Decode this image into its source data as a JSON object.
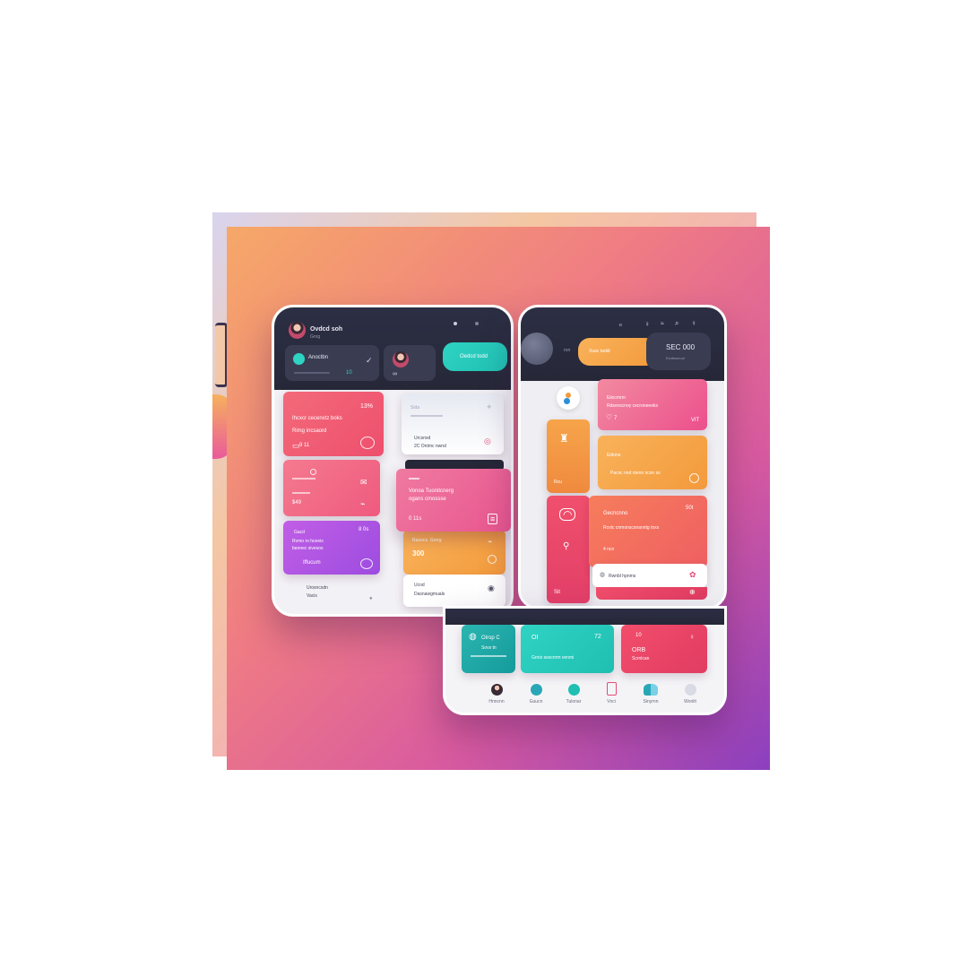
{
  "colors": {
    "dark_header": "#2c2f44",
    "teal": "#2fd3c3",
    "orange": "#f9b25a",
    "coral": "#ef5f62",
    "pink": "#f47a8f",
    "purple": "#a14fe2",
    "background_gradient": [
      "#f6a868",
      "#ef7b84",
      "#d85aa0",
      "#8b3fbf"
    ]
  },
  "left_panel": {
    "header": {
      "user_name": "Ovdcd soh",
      "user_sub": "Gnrg",
      "status_title": "Anoctbn",
      "status_value": "10",
      "teal_button": "Oedcd todd"
    },
    "cards": {
      "red_title": "Ihcxcr cecenxtz boks",
      "red_sub": "Rimg incsaord",
      "red_value": "13%",
      "red_footer": "9 11",
      "pink_value": "$49",
      "purple_title": "Gacd",
      "purple_value": "8 0s",
      "purple_line1": "Rvmo ro hceeis",
      "purple_line2": "beonec sivesos",
      "purple_footer": "Iffucum",
      "footer_line1": "Urosncsdn",
      "footer_line2": "Vacis",
      "mid_white_title": "Sida",
      "mid_white_sub": "Urcsnsd",
      "mid_white_footer": "2C Ontmc nwnd",
      "overlay_title": "Vonoa Tuonitcnerg",
      "overlay_sub": "ogans cmossse",
      "overlay_value": "0 11s",
      "orange_label": "Raoocs. Grerg",
      "orange_value": "300",
      "bottom_white_title": "Ucod",
      "bottom_white_sub": "Dasnawgmuals"
    }
  },
  "right_panel": {
    "header": {
      "search_label": "ron",
      "orange_button": "Xuac taddi",
      "balance_value": "SEC 000",
      "balance_sub": "Ecntnscruol"
    },
    "cards": {
      "pink_label": "Eiiocmrnr",
      "pink_title": "Rdsvnscnoy cecroneeeks",
      "pink_footer": "7",
      "pink_value": "VIT",
      "vertical_orange_label": "Rcu",
      "orange_label": "Eidone",
      "orange_title": "Pacsc nnd ntenn scon ss",
      "coral_title": "Gecncnno",
      "coral_value": "50t",
      "coral_line": "Rcvtc cnmonscsnanntg tnxs",
      "coral_sub": "4 ncn",
      "vertical_red_value": "Sit",
      "white_strip_label": "Rwnbl hpnms"
    }
  },
  "bottom_panel": {
    "cards": {
      "teal_dark_title": "Oirop C",
      "teal_dark_sub": "Sovs tn",
      "teal_title": "OI",
      "teal_value": "72",
      "teal_sub": "Grnio sescnrm venmi",
      "rose_title": "ORB",
      "rose_value": "10",
      "rose_sub": "Scrnlcan"
    },
    "nav": [
      {
        "label": "Hnncnn",
        "icon": "profile-icon"
      },
      {
        "label": "Guucn",
        "icon": "globe-icon"
      },
      {
        "label": "Tulonar",
        "icon": "chat-icon"
      },
      {
        "label": "Vnci",
        "icon": "document-icon"
      },
      {
        "label": "Sinyrnn",
        "icon": "users-icon"
      },
      {
        "label": "Wonlit",
        "icon": "settings-icon"
      }
    ]
  }
}
